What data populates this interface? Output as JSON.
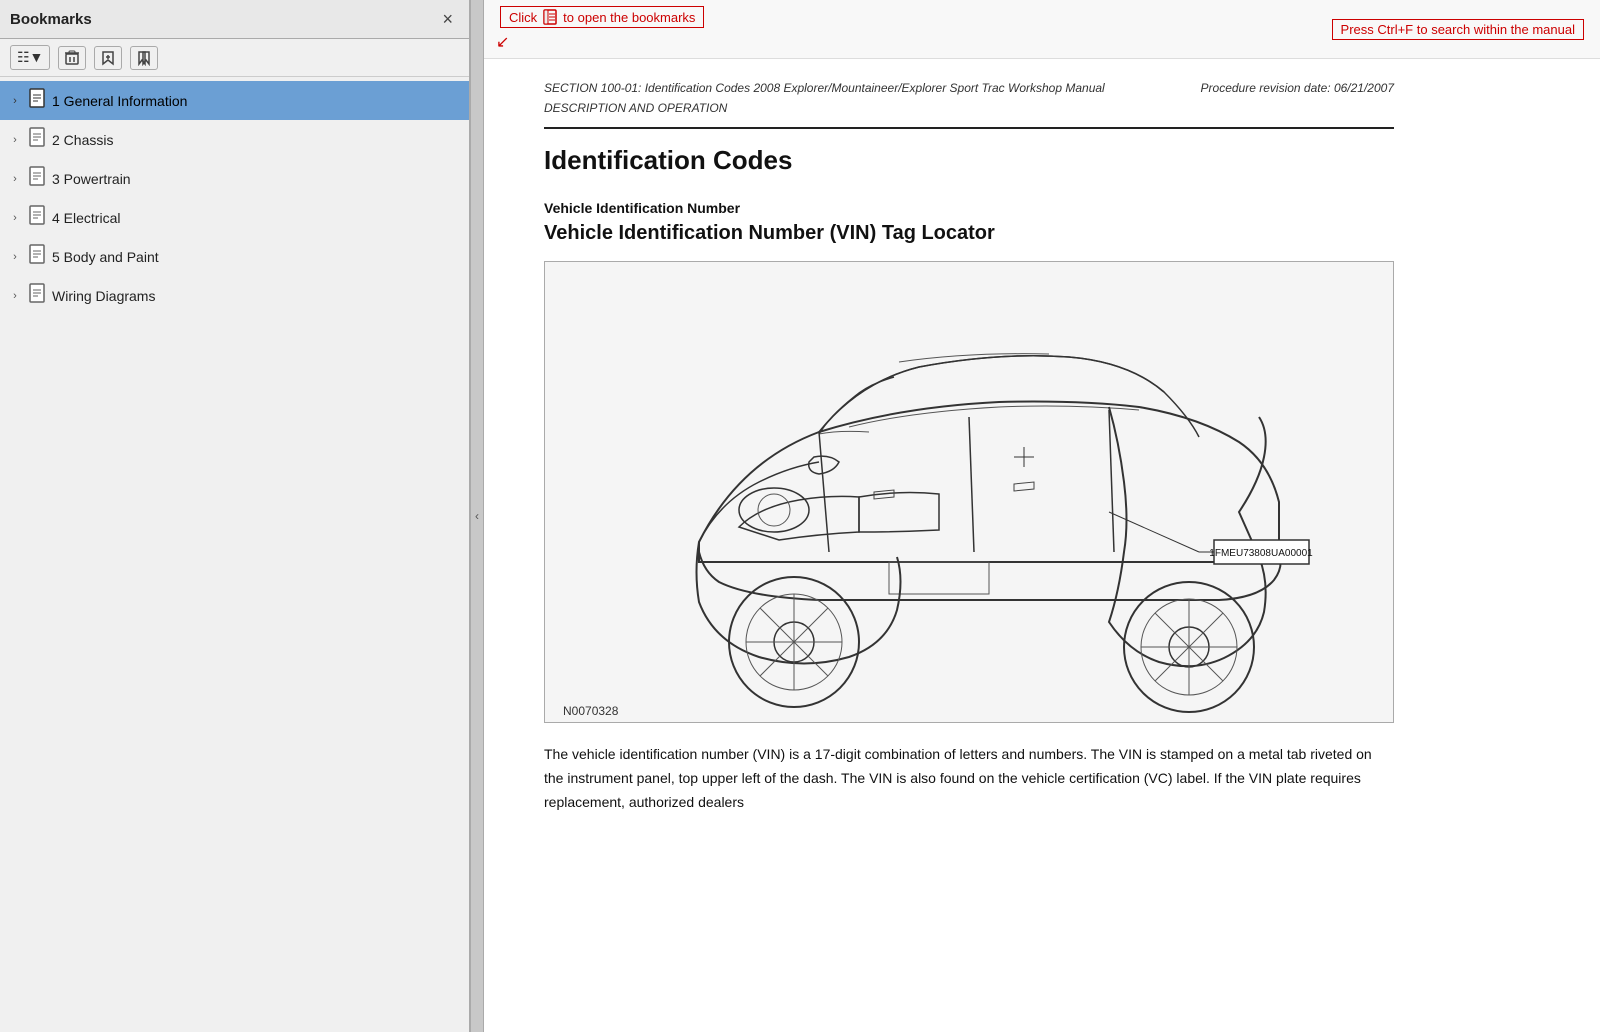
{
  "sidebar": {
    "title": "Bookmarks",
    "close_label": "×",
    "toolbar": {
      "expand_btn": "▤▾",
      "delete_btn": "🗑",
      "bookmark_add_btn": "🔖",
      "bookmark_list_btn": "🔗"
    },
    "items": [
      {
        "id": "item-1",
        "label": "1 General Information",
        "chevron": "›",
        "selected": true
      },
      {
        "id": "item-2",
        "label": "2 Chassis",
        "chevron": "›",
        "selected": false
      },
      {
        "id": "item-3",
        "label": "3 Powertrain",
        "chevron": "›",
        "selected": false
      },
      {
        "id": "item-4",
        "label": "4 Electrical",
        "chevron": "›",
        "selected": false
      },
      {
        "id": "item-5",
        "label": "5 Body and Paint",
        "chevron": "›",
        "selected": false
      },
      {
        "id": "item-6",
        "label": "Wiring Diagrams",
        "chevron": "›",
        "selected": false
      }
    ]
  },
  "hints": {
    "left": "Click  ▏  to open the bookmarks",
    "right": "Press Ctrl+F to search within the manual"
  },
  "document": {
    "section_line1": "SECTION 100-01: Identification Codes   2008 Explorer/Mountaineer/Explorer Sport Trac Workshop Manual",
    "section_line2": "DESCRIPTION AND OPERATION",
    "procedure_date": "Procedure revision date: 06/21/2007",
    "main_title": "Identification Codes",
    "sub_heading1": "Vehicle Identification Number",
    "sub_heading2": "Vehicle Identification Number (VIN) Tag Locator",
    "fig_caption": "N0070328",
    "vin_code": "1FMEU73808UA00001",
    "body_text": "The vehicle identification number (VIN) is a 17-digit combination of letters and numbers. The VIN is stamped on a metal tab riveted on the instrument panel, top upper left of the dash. The VIN is also found on the vehicle certification (VC) label. If the VIN plate requires replacement, authorized dealers"
  }
}
